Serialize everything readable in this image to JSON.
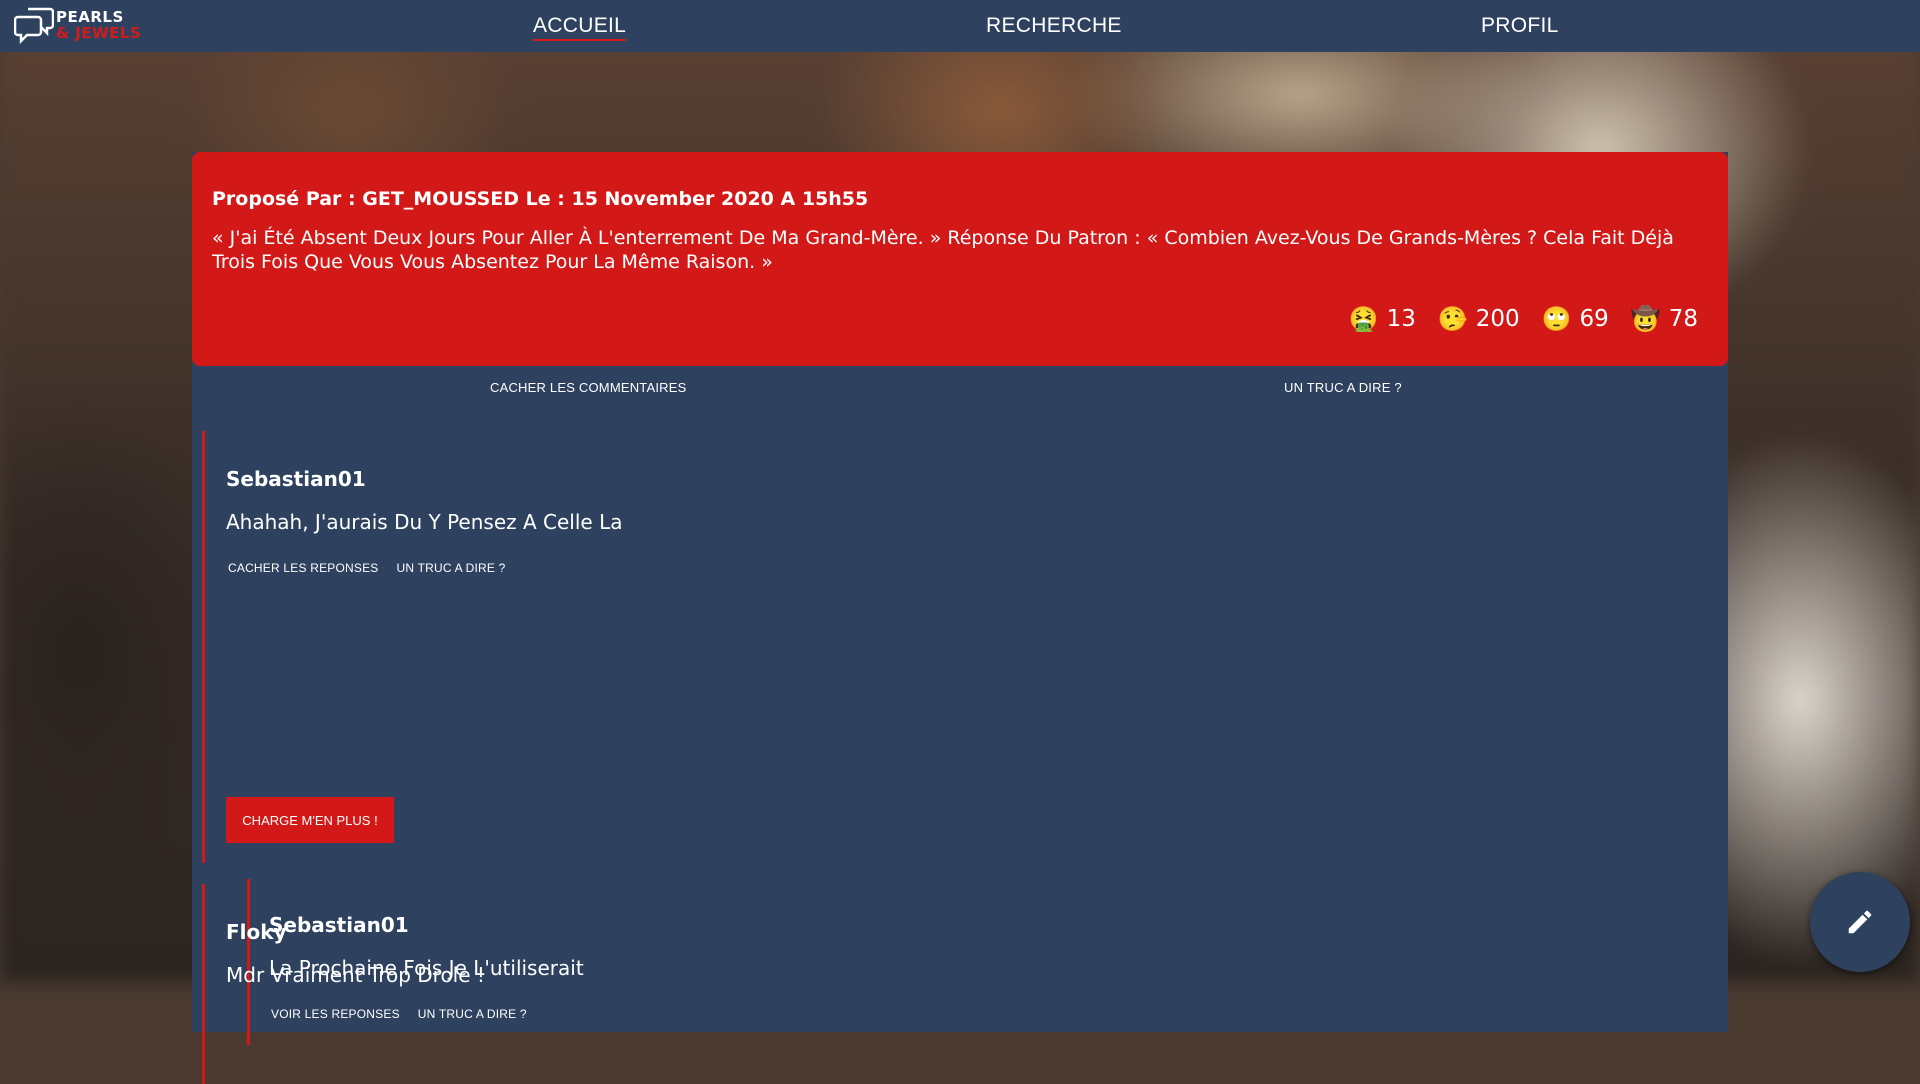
{
  "logo": {
    "line1": "PEARLS",
    "line2": "& JEWELS"
  },
  "nav": {
    "home": "ACCUEIL",
    "search": "RECHERCHE",
    "profile": "PROFIL"
  },
  "joke": {
    "meta": "Proposé Par : GET_MOUSSED Le : 15 November 2020 A 15h55",
    "text": "« J'ai Été Absent Deux Jours Pour Aller À L'enterrement De Ma Grand-Mère. » Réponse Du Patron : « Combien Avez-Vous De Grands-Mères ? Cela Fait Déjà Trois Fois Que Vous Vous Absentez Pour La Même Raison. »",
    "reactions": [
      {
        "emoji": "🤮",
        "icon": "nauseated-face-icon",
        "count": "13"
      },
      {
        "emoji": "🤥",
        "icon": "lying-face-icon",
        "count": "200"
      },
      {
        "emoji": "🙄",
        "icon": "eye-roll-icon",
        "count": "69"
      },
      {
        "emoji": "🤠",
        "icon": "cowboy-face-icon",
        "count": "78"
      }
    ]
  },
  "joke_actions": {
    "toggle_comments": "CACHER LES COMMENTAIRES",
    "say_something": "UN TRUC A DIRE ?"
  },
  "comments": [
    {
      "author": "Sebastian01",
      "body": "Ahahah, J'aurais Du Y Pensez A Celle La",
      "toggle_replies": "CACHER LES REPONSES",
      "reply": "UN TRUC A DIRE ?",
      "replies": [
        {
          "author": "Sebastian01",
          "body": "La Prochaine Fois Je L'utiliserait",
          "toggle_replies": "VOIR LES REPONSES",
          "reply": "UN TRUC A DIRE ?"
        }
      ],
      "load_more": "CHARGE M'EN PLUS !"
    },
    {
      "author": "Floky",
      "body": "Mdr Vraiment Trop Drole !"
    }
  ],
  "fab": {
    "icon": "pencil-icon"
  }
}
